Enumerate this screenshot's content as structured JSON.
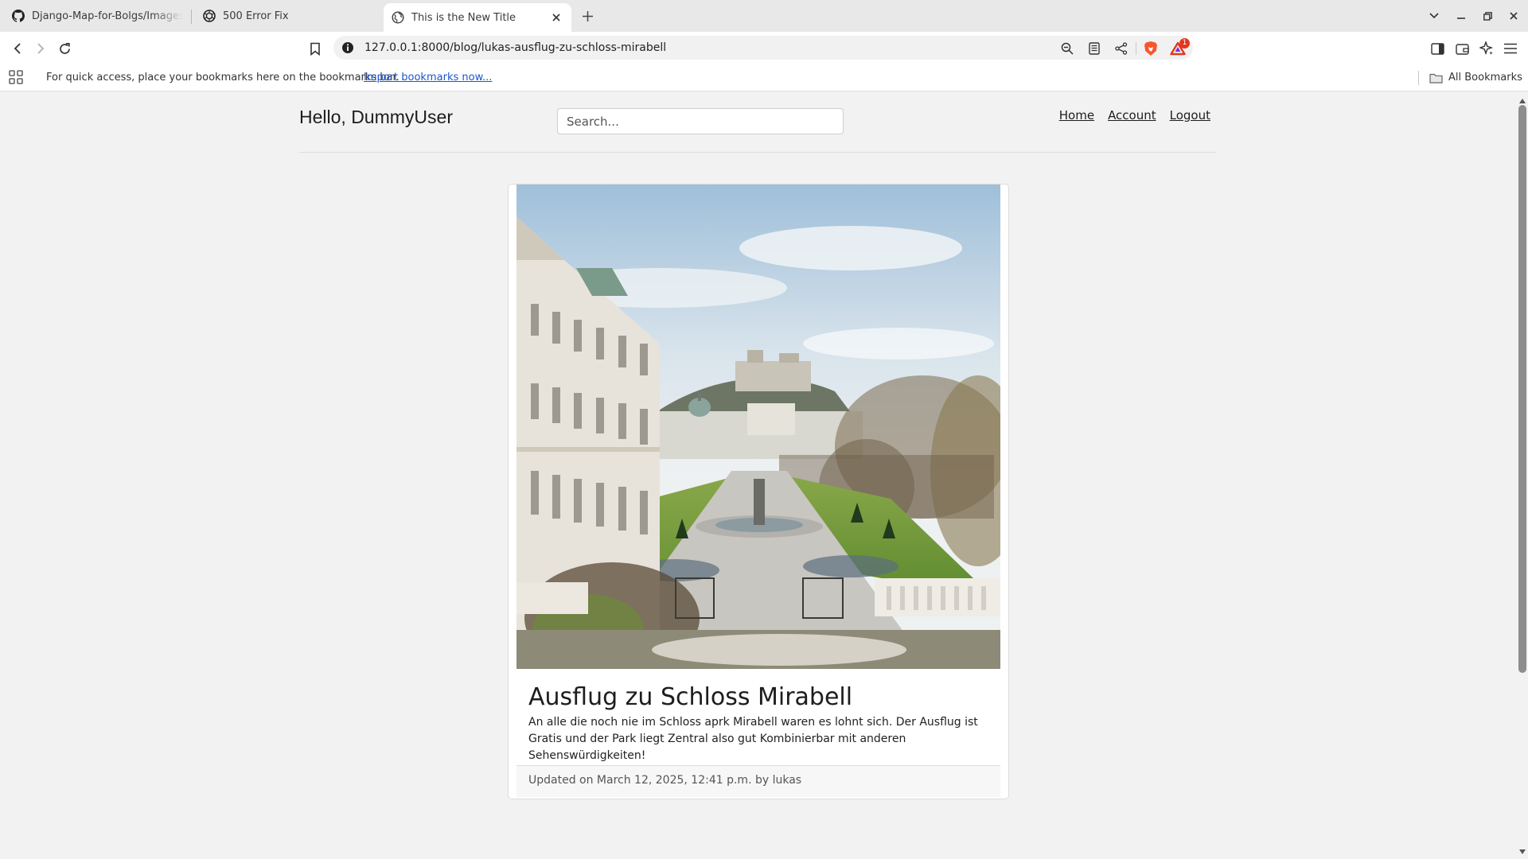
{
  "browser": {
    "tabs": [
      {
        "title": "Django-Map-for-Bolgs/Images a",
        "icon": "github-icon"
      },
      {
        "title": "500 Error Fix",
        "icon": "openai-icon"
      },
      {
        "title": "This is the New Title",
        "icon": "globe-icon",
        "active": true
      }
    ],
    "url": "127.0.0.1:8000/blog/lukas-ausflug-zu-schloss-mirabell",
    "notification_count": "1"
  },
  "bookmarks_bar": {
    "message": "For quick access, place your bookmarks here on the bookmarks bar.",
    "import_link": "Import bookmarks now...",
    "all_bookmarks": "All Bookmarks"
  },
  "header": {
    "greeting": "Hello, DummyUser",
    "search_placeholder": "Search...",
    "nav": {
      "home": "Home",
      "account": "Account",
      "logout": "Logout"
    }
  },
  "post": {
    "title": "Ausflug zu Schloss Mirabell",
    "body": "An alle die noch nie im Schloss aprk Mirabell waren es lohnt sich. Der Ausflug ist Gratis und der Park liegt Zentral also gut Kombinierbar mit anderen Sehenswürdigkeiten!",
    "footer": "Updated on March 12, 2025, 12:41 p.m. by lukas"
  },
  "colors": {
    "link": "#1a55d1",
    "brave_orange": "#fb542b",
    "rewards_red": "#e5361e"
  }
}
